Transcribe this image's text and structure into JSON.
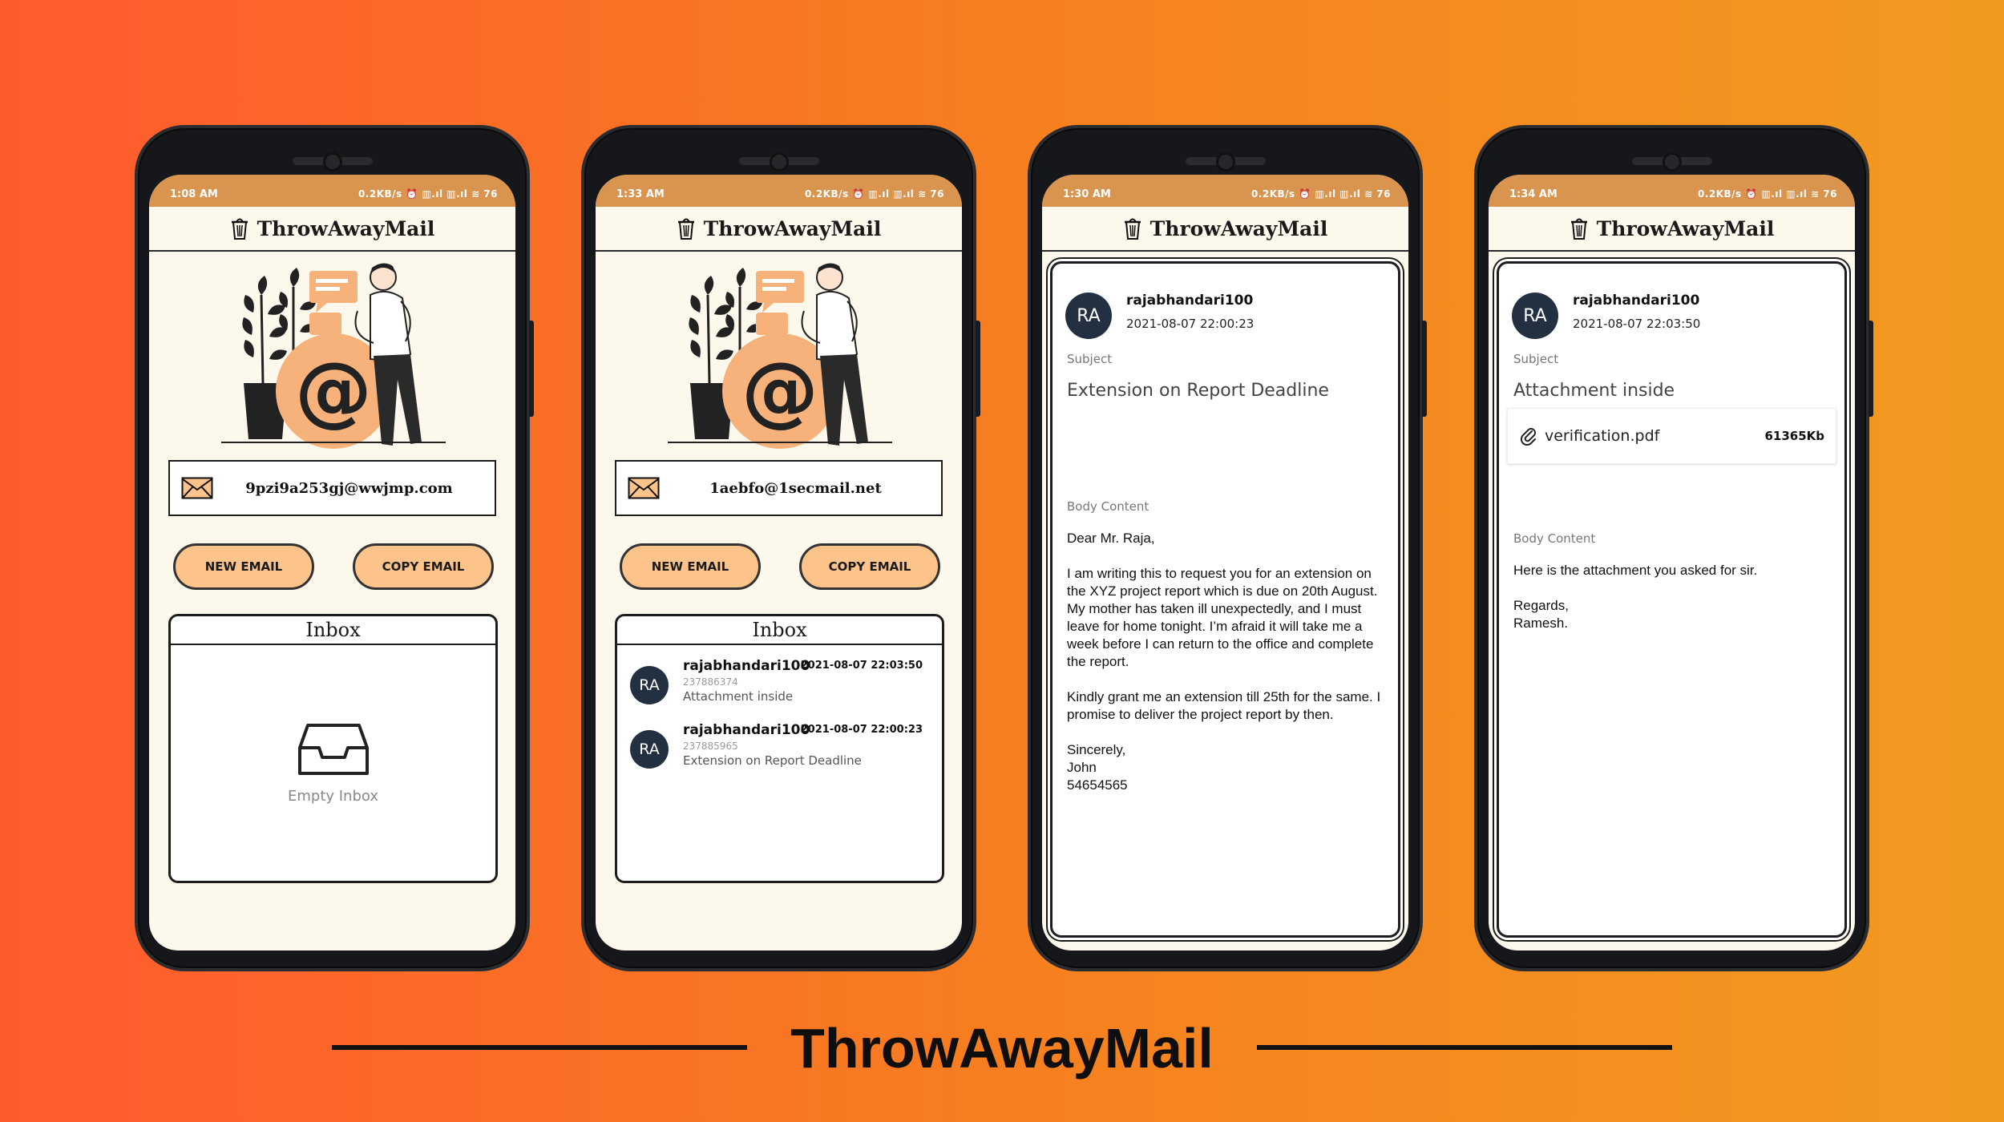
{
  "app_title": "ThrowAwayMail",
  "footer_title": "ThrowAwayMail",
  "colors": {
    "accent": "#fcc38a",
    "statusbar": "#d9944f",
    "avatar": "#223042"
  },
  "screens": [
    {
      "status": {
        "time": "1:08 AM",
        "right": "0.2KB/s ⏰ ▥.ıl ▥.ıl ≋ 76"
      },
      "email": "9pzi9a253gj@wwjmp.com",
      "new_email": "NEW EMAIL",
      "copy_email": "COPY EMAIL",
      "inbox_title": "Inbox",
      "empty_text": "Empty Inbox"
    },
    {
      "status": {
        "time": "1:33 AM",
        "right": "0.2KB/s ⏰ ▥.ıl ▥.ıl ≋ 76"
      },
      "email": "1aebfo@1secmail.net",
      "new_email": "NEW EMAIL",
      "copy_email": "COPY EMAIL",
      "inbox_title": "Inbox",
      "messages": [
        {
          "avatar": "RA",
          "from": "rajabhandari100",
          "date": "2021-08-07 22:03:50",
          "id": "237886374",
          "subject": "Attachment inside"
        },
        {
          "avatar": "RA",
          "from": "rajabhandari100",
          "date": "2021-08-07 22:00:23",
          "id": "237885965",
          "subject": "Extension on Report Deadline"
        }
      ]
    },
    {
      "status": {
        "time": "1:30 AM",
        "right": "0.2KB/s ⏰ ▥.ıl ▥.ıl ≋ 76"
      },
      "avatar": "RA",
      "from": "rajabhandari100",
      "datetime": "2021-08-07 22:00:23",
      "subject_label": "Subject",
      "subject": "Extension on Report Deadline",
      "body_label": "Body Content",
      "body": "Dear Mr. Raja,\n\nI am writing this to request you for an extension on the XYZ project report which is due on 20th August. My mother has taken ill unexpectedly, and I must leave for home tonight. I’m afraid it will take me a week before I can return to the office and complete the report.\n\nKindly grant me an extension till 25th for the same. I promise to deliver the project report by then.\n\nSincerely,\nJohn\n54654565"
    },
    {
      "status": {
        "time": "1:34 AM",
        "right": "0.2KB/s ⏰ ▥.ıl ▥.ıl ≋ 76"
      },
      "avatar": "RA",
      "from": "rajabhandari100",
      "datetime": "2021-08-07 22:03:50",
      "subject_label": "Subject",
      "subject": "Attachment inside",
      "attachment": {
        "name": "verification.pdf",
        "size": "61365Kb"
      },
      "body_label": "Body Content",
      "body": "Here is the attachment you asked for sir.\n\nRegards,\nRamesh."
    }
  ]
}
